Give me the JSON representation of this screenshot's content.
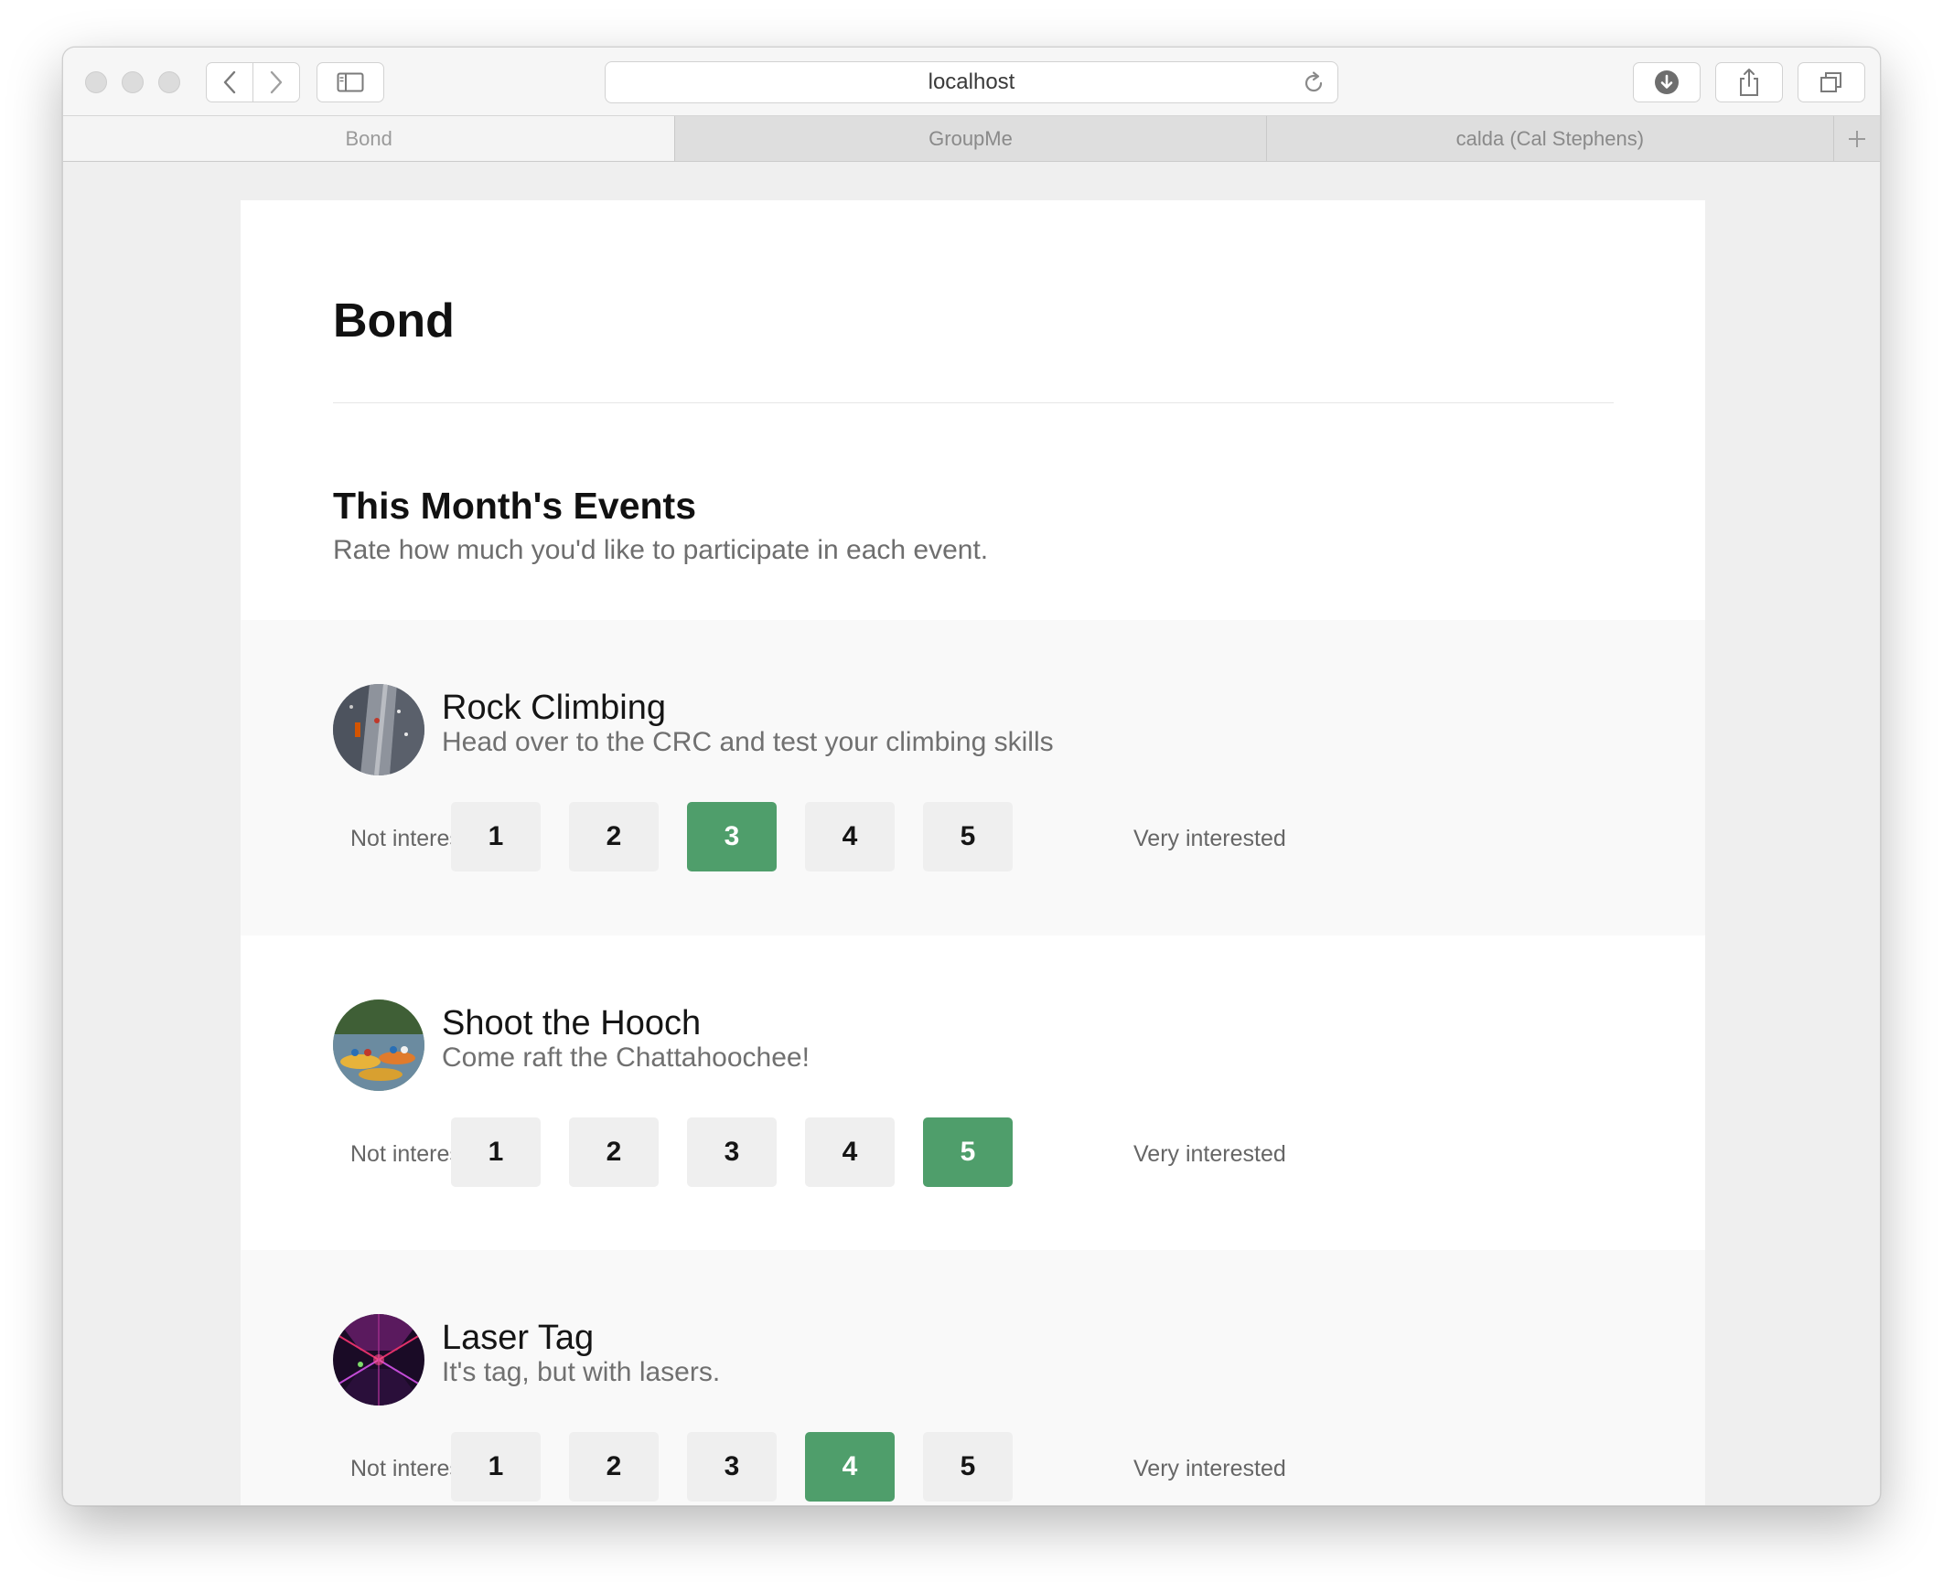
{
  "browser": {
    "url": "localhost",
    "tabs": [
      {
        "label": "Bond",
        "active": true
      },
      {
        "label": "GroupMe",
        "active": false
      },
      {
        "label": "calda (Cal Stephens)",
        "active": false
      }
    ]
  },
  "app": {
    "title": "Bond",
    "section_title": "This Month's Events",
    "section_subtitle": "Rate how much you'd like to participate in each event."
  },
  "events": [
    {
      "name": "Rock Climbing",
      "description": "Head over to the CRC and test your climbing skills",
      "scale_low": "Not interested",
      "scale_high": "Very interested",
      "options": [
        "1",
        "2",
        "3",
        "4",
        "5"
      ],
      "selected_rating": 3
    },
    {
      "name": "Shoot the Hooch",
      "description": "Come raft the Chattahoochee!",
      "scale_low": "Not interested",
      "scale_high": "Very interested",
      "options": [
        "1",
        "2",
        "3",
        "4",
        "5"
      ],
      "selected_rating": 5
    },
    {
      "name": "Laser Tag",
      "description": "It's tag, but with lasers.",
      "scale_low": "Not interested",
      "scale_high": "Very interested",
      "options": [
        "1",
        "2",
        "3",
        "4",
        "5"
      ],
      "selected_rating": 4
    }
  ],
  "colors": {
    "accent": "#4f9e6b",
    "button_bg": "#efefef",
    "alt_row_bg": "#f9f9f9"
  }
}
